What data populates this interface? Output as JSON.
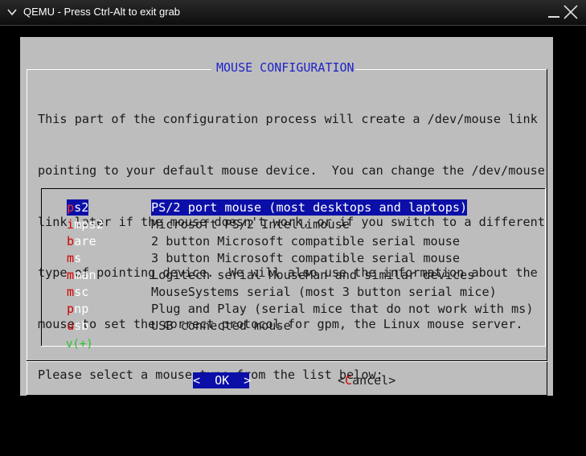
{
  "window": {
    "title": "QEMU - Press Ctrl-Alt to exit grab"
  },
  "dialog": {
    "title": "MOUSE CONFIGURATION",
    "paragraph": [
      "This part of the configuration process will create a /dev/mouse link",
      "pointing to your default mouse device.  You can change the /dev/mouse",
      "link later if the mouse doesn't work, or if you switch to a different",
      "type of pointing device.  We will also use the information about the",
      "mouse to set the correct protocol for gpm, the Linux mouse server.",
      "Please select a mouse type from the list below:"
    ],
    "list": [
      {
        "hot": "p",
        "rest": "s2",
        "desc": "PS/2 port mouse (most desktops and laptops)",
        "selected": true
      },
      {
        "hot": "i",
        "rest": "mps2",
        "desc": "Microsoft PS/2 Intellimouse",
        "selected": false
      },
      {
        "hot": "b",
        "rest": "are",
        "desc": "2 button Microsoft compatible serial mouse",
        "selected": false
      },
      {
        "hot": "m",
        "rest": "s",
        "desc": "3 button Microsoft compatible serial mouse",
        "selected": false
      },
      {
        "hot": "m",
        "rest": "man",
        "desc": "Logitech serial MouseMan and similar devices",
        "selected": false
      },
      {
        "hot": "m",
        "rest": "sc",
        "desc": "MouseSystems serial (most 3 button serial mice)",
        "selected": false
      },
      {
        "hot": "p",
        "rest": "np",
        "desc": "Plug and Play (serial mice that do not work with ms)",
        "selected": false
      },
      {
        "hot": "u",
        "rest": "sb",
        "desc": "USB connected mouse",
        "selected": false
      }
    ],
    "scroll_indicator": "v(+)",
    "ok_label": "<  OK  >",
    "cancel": {
      "open": "<",
      "hot": "C",
      "rest": "ancel",
      "close": ">"
    }
  },
  "colors": {
    "dialog_bg": "#bdbdbd",
    "selection_bg": "#0b0fa8",
    "title_fg": "#1f23c8",
    "hotkey": "#d40000",
    "scroll_indicator": "#24c424"
  }
}
